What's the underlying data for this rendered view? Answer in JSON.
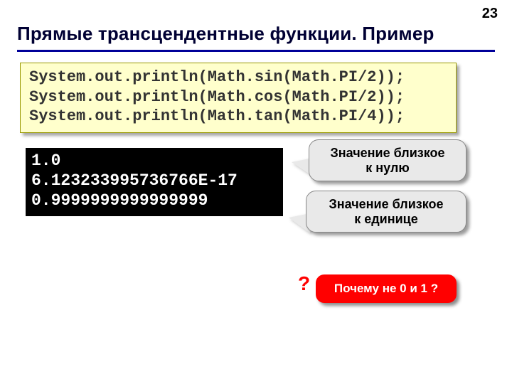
{
  "page_number": "23",
  "title": "Прямые трансцендентные функции. Пример",
  "code": {
    "line1": "System.out.println(Math.sin(Math.PI/2));",
    "line2": "System.out.println(Math.cos(Math.PI/2));",
    "line3": "System.out.println(Math.tan(Math.PI/4));"
  },
  "console": {
    "line1": "1.0",
    "line2": "6.123233995736766E-17",
    "line3": "0.9999999999999999"
  },
  "callouts": {
    "c1_line1": "Значение близкое",
    "c1_line2": "к нулю",
    "c2_line1": "Значение близкое",
    "c2_line2": "к единице"
  },
  "question": "Почему не 0 и 1 ?",
  "qmark": "?"
}
